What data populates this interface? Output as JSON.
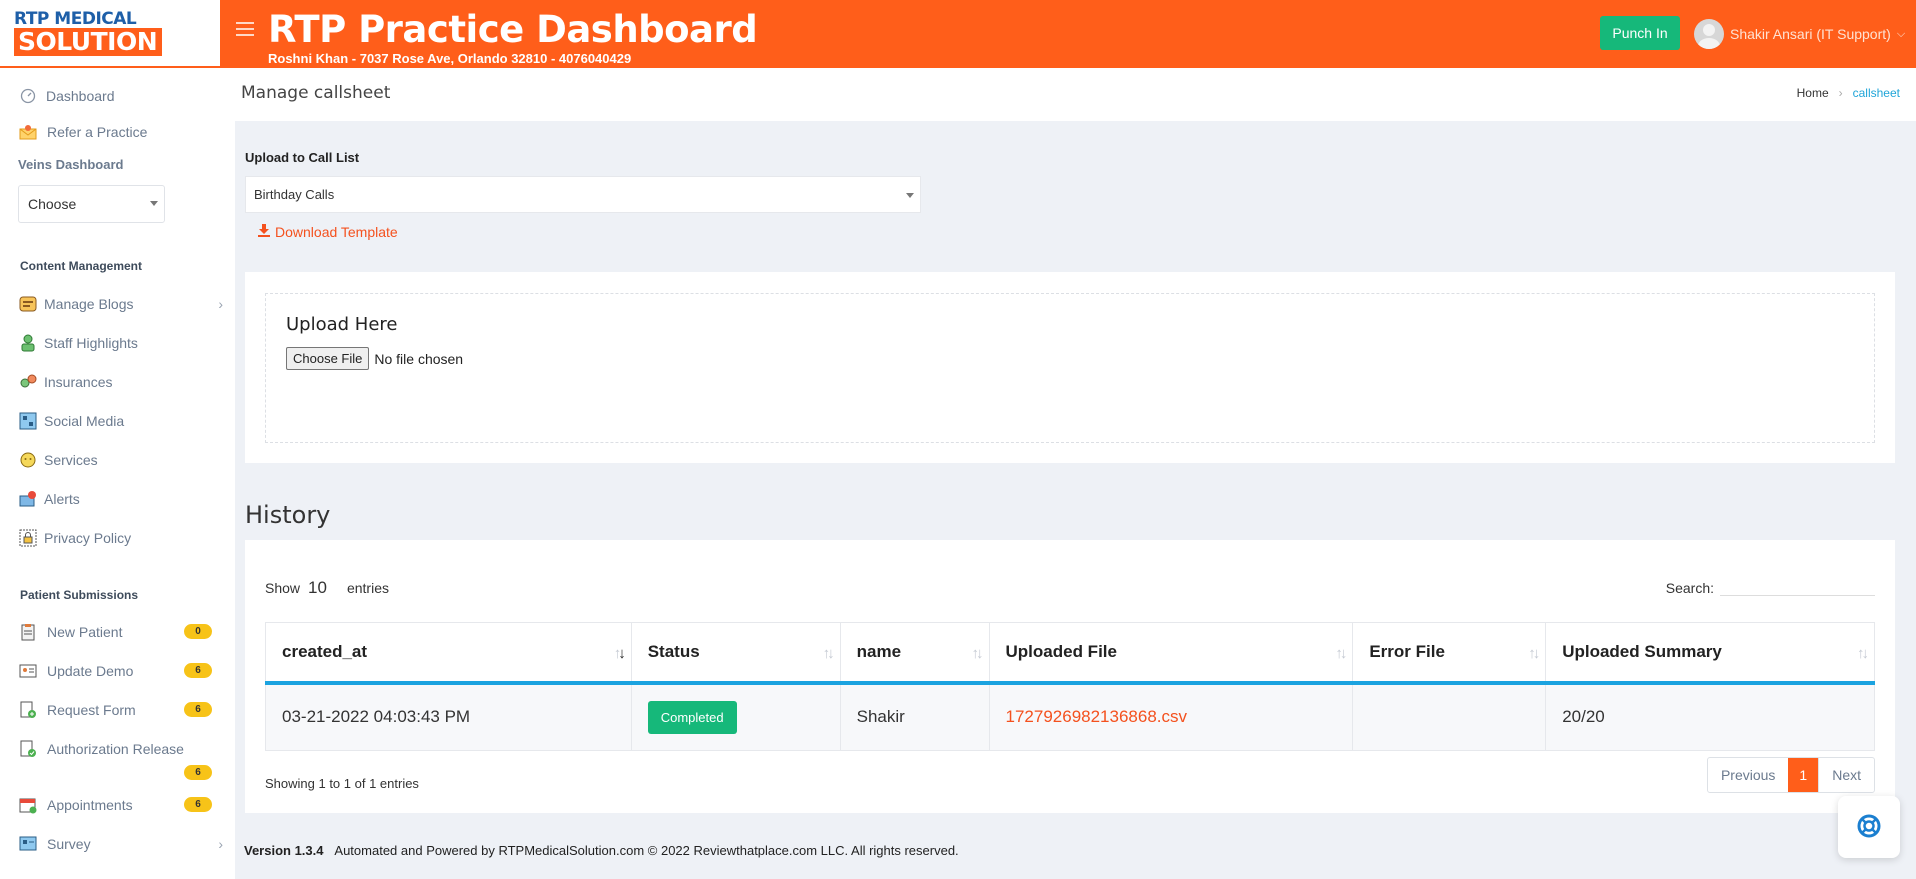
{
  "brand": {
    "logo_top": "RTP MEDICAL",
    "logo_bottom": "SOLUTION",
    "app_title": "RTP Practice Dashboard",
    "subtitle": "Roshni Khan - 7037 Rose Ave, Orlando 32810 - 4076040429"
  },
  "header": {
    "punch_label": "Punch In",
    "user_name": "Shakir Ansari (IT Support)"
  },
  "sidebar": {
    "dashboard": "Dashboard",
    "refer": "Refer a Practice",
    "veins_title": "Veins Dashboard",
    "choose": "Choose",
    "content_title": "Content Management",
    "content_items": [
      "Manage Blogs",
      "Staff Highlights",
      "Insurances",
      "Social Media",
      "Services",
      "Alerts",
      "Privacy Policy"
    ],
    "patient_title": "Patient Submissions",
    "patient_items": [
      {
        "label": "New Patient",
        "badge": "0"
      },
      {
        "label": "Update Demo",
        "badge": "6"
      },
      {
        "label": "Request Form",
        "badge": "6"
      },
      {
        "label": "Authorization Release",
        "badge": "6"
      },
      {
        "label": "Appointments",
        "badge": "6"
      },
      {
        "label": "Survey",
        "badge": ""
      }
    ]
  },
  "page": {
    "title": "Manage callsheet",
    "breadcrumb_home": "Home",
    "breadcrumb_current": "callsheet"
  },
  "upload": {
    "label": "Upload to Call List",
    "selected_list": "Birthday Calls",
    "download_template": "Download Template",
    "upload_here": "Upload Here",
    "choose_file": "Choose File",
    "no_file": "No file chosen"
  },
  "history": {
    "title": "History",
    "show_label": "Show",
    "show_count": "10",
    "entries_label": "entries",
    "search_label": "Search:",
    "columns": [
      "created_at",
      "Status",
      "name",
      "Uploaded File",
      "Error File",
      "Uploaded Summary"
    ],
    "rows": [
      {
        "created_at": "03-21-2022 04:03:43 PM",
        "status": "Completed",
        "name": "Shakir",
        "uploaded_file": "1727926982136868.csv",
        "error_file": "",
        "summary": "20/20"
      }
    ],
    "showing": "Showing 1 to 1 of 1 entries",
    "prev": "Previous",
    "page": "1",
    "next": "Next"
  },
  "footer": {
    "version": "Version 1.3.4",
    "text": "Automated and Powered by RTPMedicalSolution.com © 2022 Reviewthatplace.com LLC. All rights reserved."
  },
  "colors": {
    "brand_orange": "#ff5e1a",
    "success_green": "#16b87a",
    "accent_blue": "#1ba3e0",
    "badge_yellow": "#f7c318"
  }
}
